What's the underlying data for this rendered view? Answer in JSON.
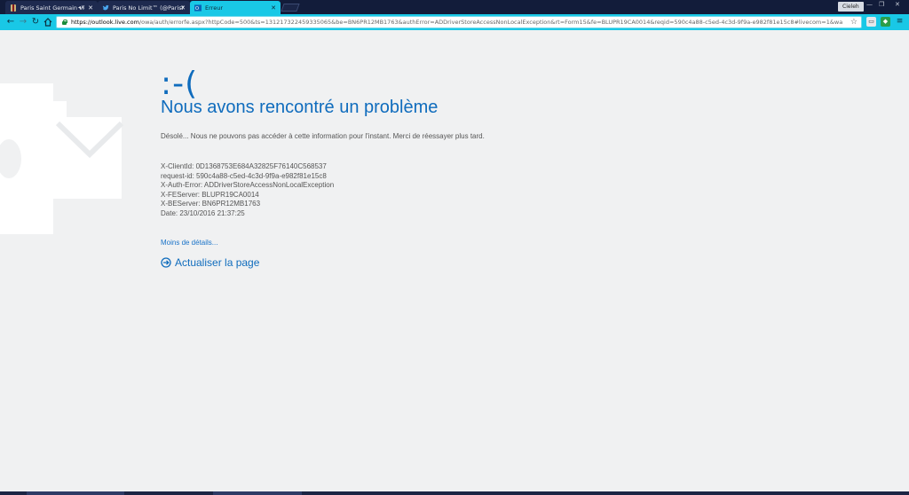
{
  "browser": {
    "tabs": [
      {
        "title": "Paris Saint Germain vi",
        "favicon": "psg-crest-icon",
        "muted": true
      },
      {
        "title": "Paris No Limit™ (@ParisNoLimit)",
        "favicon": "twitter-bird-icon",
        "muted": false
      },
      {
        "title": "Erreur",
        "favicon": "outlook-icon",
        "muted": false
      }
    ],
    "user": "Cieleh",
    "url_host": "https://outlook.live.com",
    "url_path": "/owa/auth/errorfe.aspx?httpCode=500&ts=131217322459335065&be=BN6PR12MB1763&authError=ADDriverStoreAccessNonLocalException&rt=Form15&fe=BLUPR19CA0014&reqid=590c4a88-c5ed-4c3d-9f9a-e982f81e15c8#livecom=1&wa"
  },
  "error": {
    "emoticon": ":-(",
    "heading": "Nous avons rencontré un problème",
    "description": "Désolé... Nous ne pouvons pas accéder à cette information pour l'instant. Merci de réessayer plus tard.",
    "details": [
      "X-ClientId: 0D1368753E684A32825F76140C568537",
      "request-id: 590c4a88-c5ed-4c3d-9f9a-e982f81e15c8",
      "X-Auth-Error: ADDriverStoreAccessNonLocalException",
      "X-FEServer: BLUPR19CA0014",
      "X-BEServer: BN6PR12MB1763",
      "Date: 23/10/2016 21:37:25"
    ],
    "less_details": "Moins de détails...",
    "refresh": "Actualiser la page"
  },
  "colors": {
    "accent": "#0f6cbd",
    "toolbar": "#19c8e6",
    "tabstrip": "#121c3a"
  }
}
